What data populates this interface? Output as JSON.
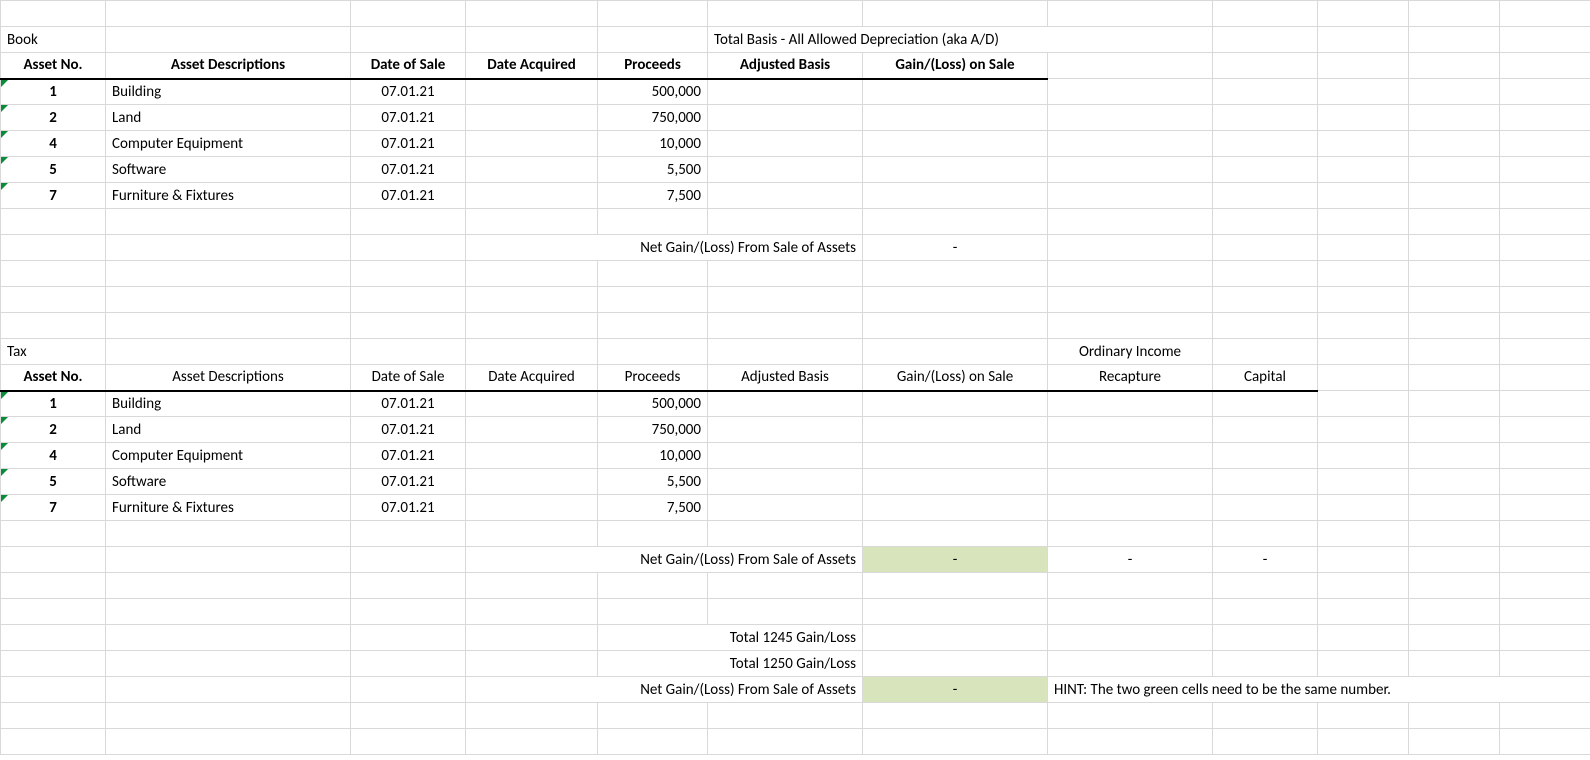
{
  "book": {
    "section_label": "Book",
    "note": "Total Basis - All Allowed Depreciation (aka A/D)",
    "headers": {
      "asset_no": "Asset No.",
      "asset_desc": "Asset Descriptions",
      "date_of_sale": "Date of Sale",
      "date_acquired": "Date Acquired",
      "proceeds": "Proceeds",
      "adjusted_basis": "Adjusted Basis",
      "gain_loss": "Gain/(Loss) on Sale"
    },
    "rows": [
      {
        "no": "1",
        "desc": "Building",
        "date_of_sale": "07.01.21",
        "date_acquired": "",
        "proceeds": "500,000",
        "adjusted_basis": "",
        "gain_loss": ""
      },
      {
        "no": "2",
        "desc": "Land",
        "date_of_sale": "07.01.21",
        "date_acquired": "",
        "proceeds": "750,000",
        "adjusted_basis": "",
        "gain_loss": ""
      },
      {
        "no": "4",
        "desc": "Computer Equipment",
        "date_of_sale": "07.01.21",
        "date_acquired": "",
        "proceeds": "10,000",
        "adjusted_basis": "",
        "gain_loss": ""
      },
      {
        "no": "5",
        "desc": "Software",
        "date_of_sale": "07.01.21",
        "date_acquired": "",
        "proceeds": "5,500",
        "adjusted_basis": "",
        "gain_loss": ""
      },
      {
        "no": "7",
        "desc": "Furniture & Fixtures",
        "date_of_sale": "07.01.21",
        "date_acquired": "",
        "proceeds": "7,500",
        "adjusted_basis": "",
        "gain_loss": ""
      }
    ],
    "total_label": "Net Gain/(Loss) From Sale of Assets",
    "total_value": "-"
  },
  "tax": {
    "section_label": "Tax",
    "extra_header_top": "Ordinary Income",
    "headers": {
      "asset_no": "Asset No.",
      "asset_desc": "Asset Descriptions",
      "date_of_sale": "Date of Sale",
      "date_acquired": "Date Acquired",
      "proceeds": "Proceeds",
      "adjusted_basis": "Adjusted Basis",
      "gain_loss": "Gain/(Loss) on Sale",
      "recapture": "Recapture",
      "capital": "Capital"
    },
    "rows": [
      {
        "no": "1",
        "desc": "Building",
        "date_of_sale": "07.01.21",
        "date_acquired": "",
        "proceeds": "500,000",
        "adjusted_basis": "",
        "gain_loss": "",
        "recapture": "",
        "capital": ""
      },
      {
        "no": "2",
        "desc": "Land",
        "date_of_sale": "07.01.21",
        "date_acquired": "",
        "proceeds": "750,000",
        "adjusted_basis": "",
        "gain_loss": "",
        "recapture": "",
        "capital": ""
      },
      {
        "no": "4",
        "desc": "Computer Equipment",
        "date_of_sale": "07.01.21",
        "date_acquired": "",
        "proceeds": "10,000",
        "adjusted_basis": "",
        "gain_loss": "",
        "recapture": "",
        "capital": ""
      },
      {
        "no": "5",
        "desc": "Software",
        "date_of_sale": "07.01.21",
        "date_acquired": "",
        "proceeds": "5,500",
        "adjusted_basis": "",
        "gain_loss": "",
        "recapture": "",
        "capital": ""
      },
      {
        "no": "7",
        "desc": "Furniture & Fixtures",
        "date_of_sale": "07.01.21",
        "date_acquired": "",
        "proceeds": "7,500",
        "adjusted_basis": "",
        "gain_loss": "",
        "recapture": "",
        "capital": ""
      }
    ],
    "total_label": "Net Gain/(Loss) From Sale of Assets",
    "total_gain": "-",
    "total_recapture": "-",
    "total_capital": "-",
    "t1245_label": "Total 1245 Gain/Loss",
    "t1250_label": "Total 1250 Gain/Loss",
    "net_label2": "Net Gain/(Loss) From Sale of Assets",
    "net_value2": "-",
    "hint": "HINT: The two green cells need to be the same number."
  }
}
